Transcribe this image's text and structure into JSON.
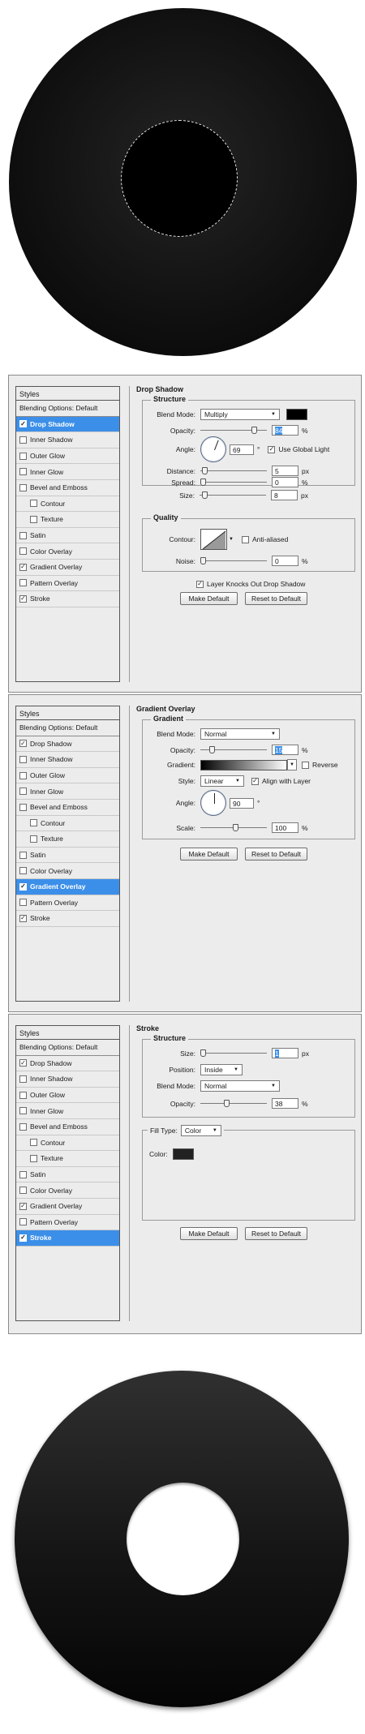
{
  "styles_list": {
    "header": "Styles",
    "blending": "Blending Options: Default",
    "items": [
      "Drop Shadow",
      "Inner Shadow",
      "Outer Glow",
      "Inner Glow",
      "Bevel and Emboss",
      "Contour",
      "Texture",
      "Satin",
      "Color Overlay",
      "Gradient Overlay",
      "Pattern Overlay",
      "Stroke"
    ]
  },
  "panels": [
    {
      "checked": [
        true,
        false,
        false,
        false,
        false,
        false,
        false,
        false,
        false,
        true,
        false,
        true
      ],
      "selected": 0
    },
    {
      "checked": [
        true,
        false,
        false,
        false,
        false,
        false,
        false,
        false,
        false,
        true,
        false,
        true
      ],
      "selected": 9
    },
    {
      "checked": [
        true,
        false,
        false,
        false,
        false,
        false,
        false,
        false,
        false,
        true,
        false,
        true
      ],
      "selected": 11
    }
  ],
  "drop_shadow": {
    "title": "Drop Shadow",
    "structure": "Structure",
    "blend_mode_label": "Blend Mode:",
    "blend_mode": "Multiply",
    "shadow_color": "#000000",
    "opacity_label": "Opacity:",
    "opacity": "84",
    "opacity_pct": 84,
    "angle_label": "Angle:",
    "angle": "69",
    "angle_unit": "°",
    "use_global_light": "Use Global Light",
    "use_global_light_checked": true,
    "distance_label": "Distance:",
    "distance": "5",
    "spread_label": "Spread:",
    "spread": "0",
    "size_label": "Size:",
    "size": "8",
    "quality": "Quality",
    "contour_label": "Contour:",
    "anti_aliased": "Anti-aliased",
    "noise_label": "Noise:",
    "noise": "0",
    "knocks_out": "Layer Knocks Out Drop Shadow",
    "knocks_out_checked": true,
    "make_default": "Make Default",
    "reset_default": "Reset to Default",
    "px": "px",
    "pct": "%"
  },
  "gradient_overlay": {
    "title": "Gradient Overlay",
    "group": "Gradient",
    "blend_mode_label": "Blend Mode:",
    "blend_mode": "Normal",
    "opacity_label": "Opacity:",
    "opacity": "15",
    "opacity_pct": 15,
    "gradient_label": "Gradient:",
    "reverse": "Reverse",
    "style_label": "Style:",
    "style": "Linear",
    "align_layer": "Align with Layer",
    "align_layer_checked": true,
    "angle_label": "Angle:",
    "angle": "90",
    "angle_unit": "°",
    "scale_label": "Scale:",
    "scale": "100",
    "pct": "%",
    "make_default": "Make Default",
    "reset_default": "Reset to Default"
  },
  "stroke": {
    "title": "Stroke",
    "structure": "Structure",
    "size_label": "Size:",
    "size": "1",
    "px": "px",
    "position_label": "Position:",
    "position": "Inside",
    "blend_mode_label": "Blend Mode:",
    "blend_mode": "Normal",
    "opacity_label": "Opacity:",
    "opacity": "38",
    "opacity_pct": 38,
    "pct": "%",
    "fill_type_label": "Fill Type:",
    "fill_type": "Color",
    "color_label": "Color:",
    "stroke_color": "#222222",
    "make_default": "Make Default",
    "reset_default": "Reset to Default"
  }
}
